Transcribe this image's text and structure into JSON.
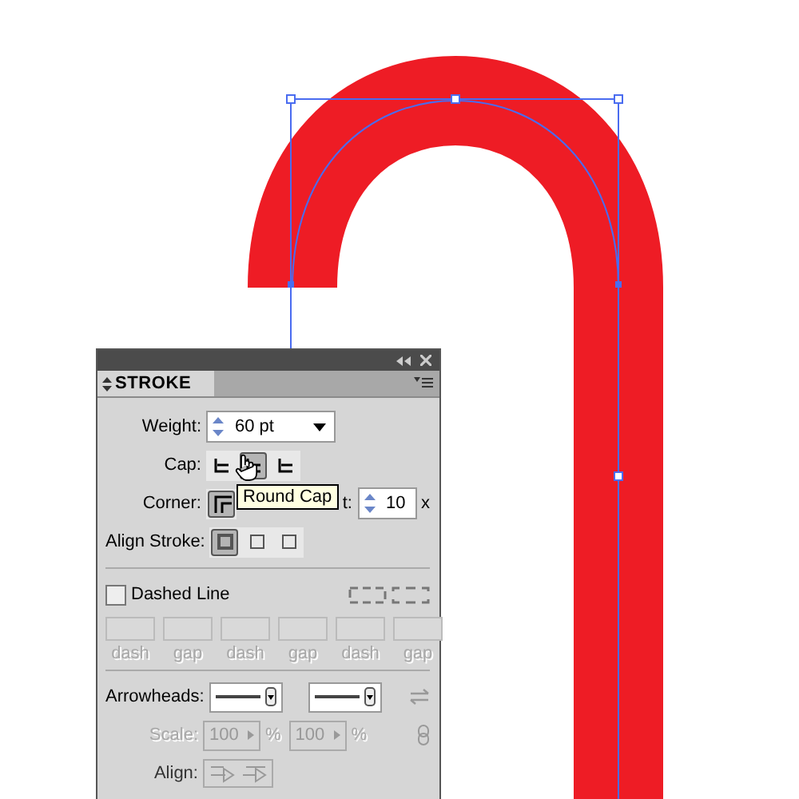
{
  "panel": {
    "title": "STROKE",
    "weight": {
      "label": "Weight:",
      "value": "60 pt"
    },
    "cap": {
      "label": "Cap:",
      "options": [
        {
          "selected": false
        },
        {
          "selected": true
        },
        {
          "selected": false
        }
      ]
    },
    "corner": {
      "label": "Corner:",
      "limit_label": "t:",
      "limit": "10",
      "limit_unit": "x"
    },
    "align_stroke": {
      "label": "Align Stroke:",
      "options": [
        {
          "selected": true
        },
        {
          "selected": false
        },
        {
          "selected": false
        }
      ]
    },
    "dashed": {
      "label": "Dashed Line",
      "checked": false,
      "disabled": true,
      "fields": [
        "dash",
        "gap",
        "dash",
        "gap",
        "dash",
        "gap"
      ]
    },
    "arrowheads": {
      "label": "Arrowheads:"
    },
    "scale": {
      "label": "Scale:",
      "values": [
        "100",
        "100"
      ],
      "unit": "%",
      "disabled": true
    },
    "align": {
      "label": "Align:"
    }
  },
  "tooltip": "Round Cap"
}
